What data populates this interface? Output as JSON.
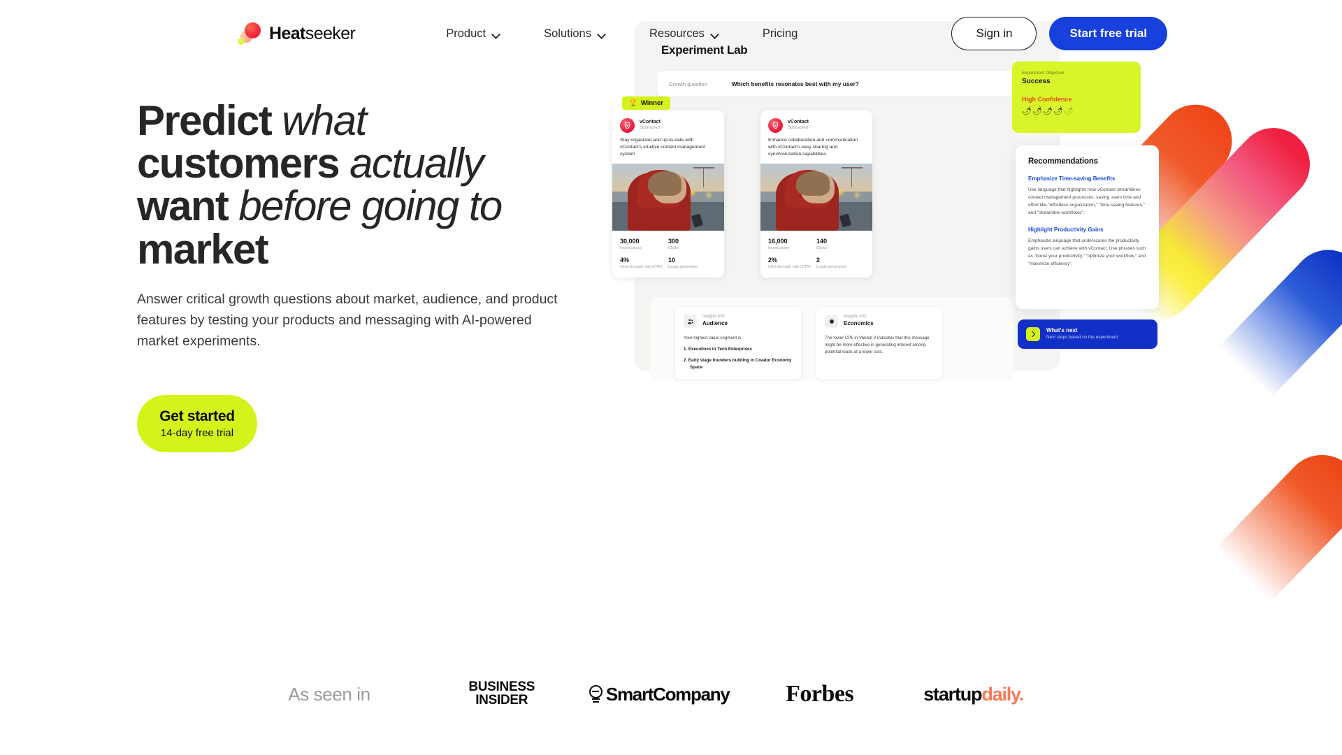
{
  "brand": {
    "name_bold": "Heat",
    "name_light": "seeker",
    "mark": "heatseeker-logo"
  },
  "nav": {
    "items": [
      {
        "label": "Product",
        "has_dropdown": true
      },
      {
        "label": "Solutions",
        "has_dropdown": true
      },
      {
        "label": "Resources",
        "has_dropdown": true
      },
      {
        "label": "Pricing",
        "has_dropdown": false
      }
    ],
    "sign_in": "Sign in",
    "start_trial": "Start free trial"
  },
  "hero": {
    "headline": {
      "l1_bold": "Predict",
      "l1_italic": "what",
      "l2_bold": "customers",
      "l2_italic": "actually",
      "l3_bold": "want",
      "l3_italic": "before going to",
      "l4_bold": "market"
    },
    "subtitle": "Answer critical growth questions about market, audience, and product features by testing your products and messaging with AI-powered market experiments.",
    "cta_main": "Get started",
    "cta_sub": "14-day free trial"
  },
  "mockup": {
    "title": "Experiment Lab",
    "growth_question_label": "Growth question",
    "growth_question_value": "Which benefits resonates best with my user?",
    "winner_badge": "Winner",
    "winner_icon": "trophy",
    "objective": {
      "label": "Experiment Objective",
      "value": "Success",
      "confidence": "High Confidence",
      "chili_filled": 4,
      "chili_total": 5
    },
    "ads": [
      {
        "brand": "vContact",
        "meta": "Sponsored · ",
        "copy": "Stay organized and up-to-date with vContact's intuitive contact management system",
        "stats": [
          {
            "value": "30,000",
            "label": "Impressions"
          },
          {
            "value": "300",
            "label": "Clicks"
          },
          {
            "value": "4%",
            "label": "Click-through rate (CTR)"
          },
          {
            "value": "10",
            "label": "Leads generated"
          }
        ]
      },
      {
        "brand": "vContact",
        "meta": "Sponsored · ",
        "copy": "Enhance collaboration and communication with vContact's easy sharing and synchronization capabilities.",
        "stats": [
          {
            "value": "16,000",
            "label": "Impressions"
          },
          {
            "value": "140",
            "label": "Clicks"
          },
          {
            "value": "2%",
            "label": "Click-through rate (CTR)"
          },
          {
            "value": "2",
            "label": "Leads generated"
          }
        ]
      }
    ],
    "insights": [
      {
        "number": "Insights #01",
        "title": "Audience",
        "icon": "audience-people-icon",
        "intro": "Your highest value segment is",
        "item1": "1. Executives in Tech Enterprises",
        "item2": "2. Early stage founders building in Creator Economy Space"
      },
      {
        "number": "Insights #02",
        "title": "Economics",
        "icon": "economics-icon",
        "intro": "The lower CPL in Variant 2 indicates that this message might be more effective in generating interest among potential leads at a lower cost.",
        "item1": "",
        "item2": ""
      }
    ],
    "recommendations": {
      "title": "Recommendations",
      "items": [
        {
          "heading": "Emphasize Time-saving Benefits",
          "body": "Use language that highlights how vContact streamlines contact management processes, saving users time and effort like \"effortless organization,\" \"time-saving features,\" and \"streamline workflows\"."
        },
        {
          "heading": "Highlight Productivity Gains",
          "body": "Emphasize language that underscores the productivity gains users can achieve with vContact. Use phrases such as \"boost your productivity,\" \"optimize your workflow,\" and \"maximize efficiency\"."
        }
      ]
    },
    "whats_next": {
      "title": "What's next",
      "subtitle": "Next steps based on the experiment",
      "icon": "chevron-right-icon"
    }
  },
  "press": {
    "label": "As seen in",
    "logos": [
      {
        "name": "business-insider",
        "line1": "BUSINESS",
        "line2": "INSIDER"
      },
      {
        "name": "smartcompany",
        "text": "SmartCompany"
      },
      {
        "name": "forbes",
        "text": "Forbes"
      },
      {
        "name": "startup-daily",
        "text_dark": "startup",
        "text_accent": "daily."
      }
    ]
  },
  "colors": {
    "lime": "#d4f31a",
    "blue": "#1840dd",
    "deep_blue": "#1230c8",
    "red": "#ea1d3c",
    "orange": "#f05a2a",
    "coral": "#f4795b",
    "rec_link": "#1b4bdd"
  }
}
